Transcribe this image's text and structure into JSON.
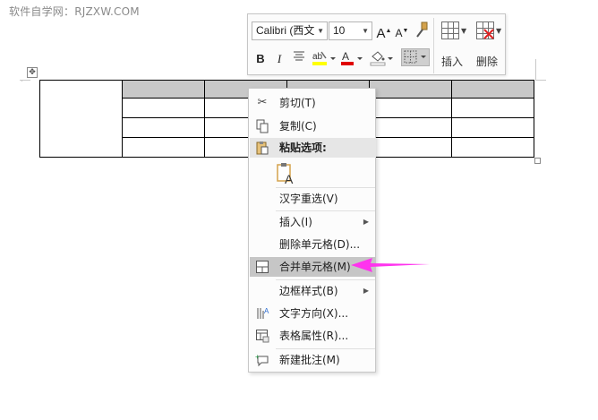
{
  "watermark": "软件自学网：RJZXW.COM",
  "toolbar": {
    "font_name": "Calibri (西文",
    "font_size": "10",
    "grow_font": "A",
    "shrink_font": "A",
    "bold": "B",
    "italic": "I",
    "insert_label": "插入",
    "delete_label": "删除",
    "highlight_color": "#ffff00",
    "font_color": "#e00000"
  },
  "menu": {
    "cut": "剪切(T)",
    "copy": "复制(C)",
    "paste_options": "粘贴选项:",
    "reselect": "汉字重选(V)",
    "insert": "插入(I)",
    "delete_cells": "删除单元格(D)...",
    "merge_cells": "合并单元格(M)",
    "border_styles": "边框样式(B)",
    "text_direction": "文字方向(X)...",
    "table_properties": "表格属性(R)...",
    "new_comment": "新建批注(M)"
  },
  "colors": {
    "arrow": "#ff33ee",
    "header_fill": "#c8c8c8",
    "hover": "#c6c6c6"
  }
}
